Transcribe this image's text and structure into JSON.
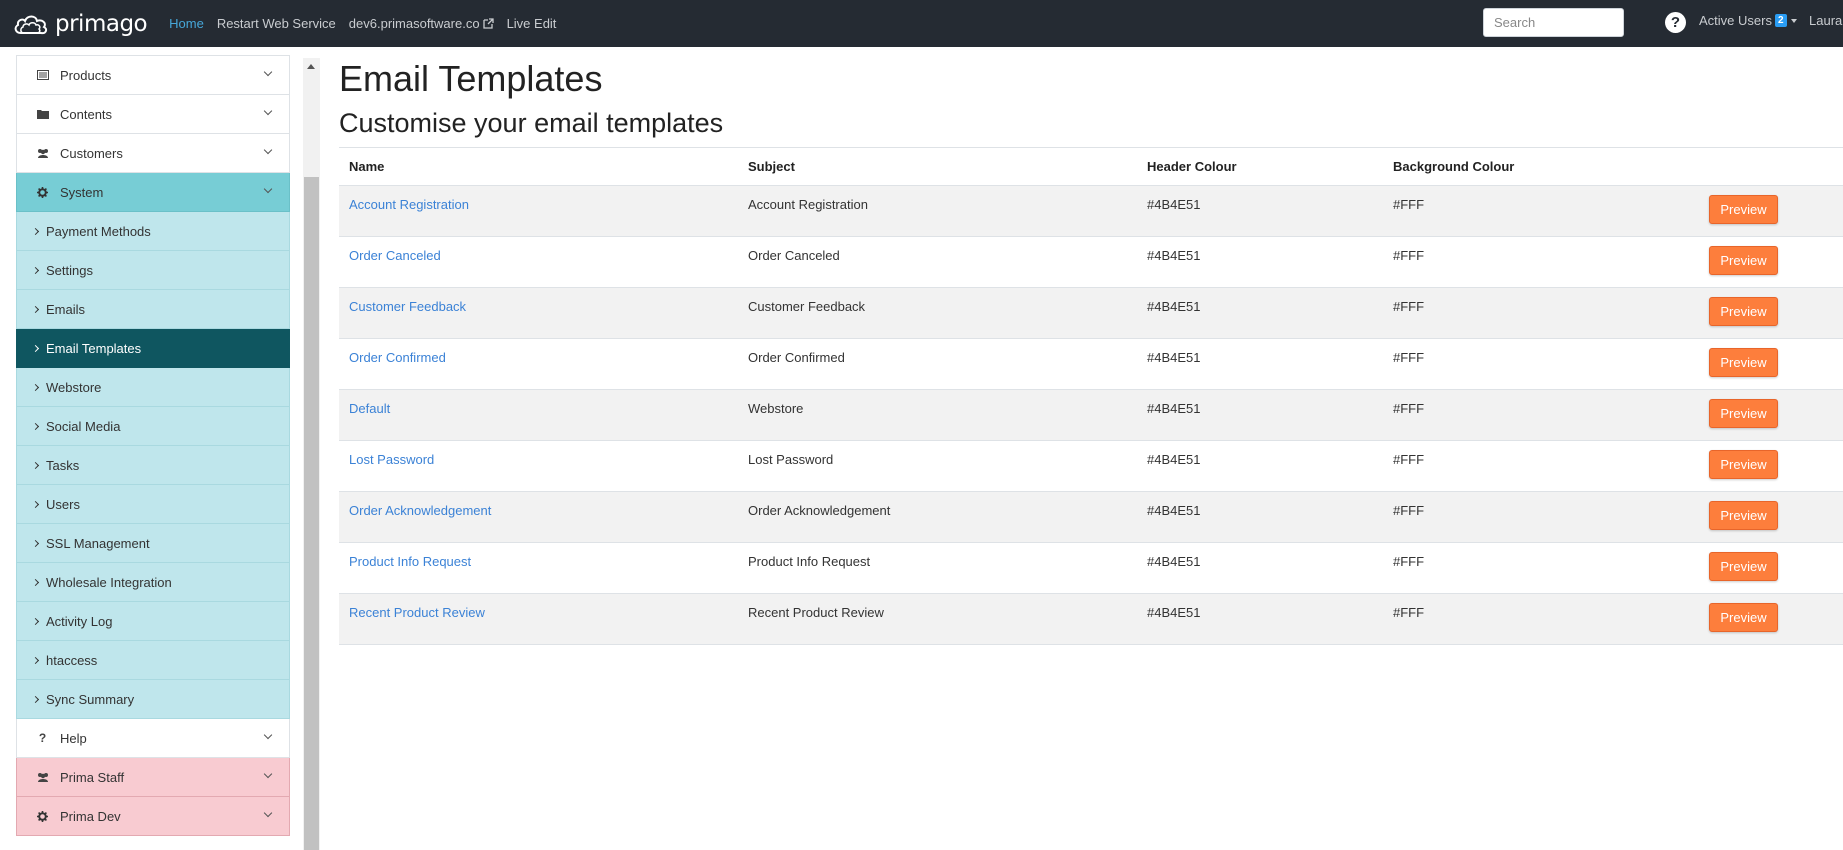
{
  "topbar": {
    "brand": "primago",
    "nav": [
      {
        "label": "Home"
      },
      {
        "label": "Restart Web Service"
      },
      {
        "label": "dev6.primasoftware.co"
      },
      {
        "label": "Live Edit"
      }
    ],
    "search_placeholder": "Search",
    "help": "?",
    "active_users_label": "Active Users",
    "active_users_count": "2",
    "user_name": "Laura",
    "colors": {
      "bar": "#252b33",
      "active_link": "#46a7d9",
      "badge": "#2a9df4"
    }
  },
  "sidebar": {
    "top_items": [
      {
        "label": "Products",
        "icon": "list-icon"
      },
      {
        "label": "Contents",
        "icon": "folder-icon"
      },
      {
        "label": "Customers",
        "icon": "users-icon"
      },
      {
        "label": "System",
        "icon": "gear-icon"
      }
    ],
    "system_items": [
      {
        "label": "Payment Methods"
      },
      {
        "label": "Settings"
      },
      {
        "label": "Emails"
      },
      {
        "label": "Email Templates"
      },
      {
        "label": "Webstore"
      },
      {
        "label": "Social Media"
      },
      {
        "label": "Tasks"
      },
      {
        "label": "Users"
      },
      {
        "label": "SSL Management"
      },
      {
        "label": "Wholesale Integration"
      },
      {
        "label": "Activity Log"
      },
      {
        "label": "htaccess"
      },
      {
        "label": "Sync Summary"
      }
    ],
    "active_item": "Email Templates",
    "bottom_items": [
      {
        "label": "Help",
        "icon": "question-icon"
      },
      {
        "label": "Prima Staff",
        "icon": "users-icon"
      },
      {
        "label": "Prima Dev",
        "icon": "gear-icon"
      }
    ],
    "colors": {
      "system": "#77cdd5",
      "sub": "#bfe6ec",
      "active": "#0f5660",
      "staff": "#f8cbd1"
    }
  },
  "main": {
    "title": "Email Templates",
    "subtitle": "Customise your email templates",
    "columns": [
      "Name",
      "Subject",
      "Header Colour",
      "Background Colour",
      ""
    ],
    "rows": [
      {
        "name": "Account Registration",
        "subject": "Account Registration",
        "header": "#4B4E51",
        "background": "#FFF",
        "action": "Preview"
      },
      {
        "name": "Order Canceled",
        "subject": "Order Canceled",
        "header": "#4B4E51",
        "background": "#FFF",
        "action": "Preview"
      },
      {
        "name": "Customer Feedback",
        "subject": "Customer Feedback",
        "header": "#4B4E51",
        "background": "#FFF",
        "action": "Preview"
      },
      {
        "name": "Order Confirmed",
        "subject": "Order Confirmed",
        "header": "#4B4E51",
        "background": "#FFF",
        "action": "Preview"
      },
      {
        "name": "Default",
        "subject": "Webstore",
        "header": "#4B4E51",
        "background": "#FFF",
        "action": "Preview"
      },
      {
        "name": "Lost Password",
        "subject": "Lost Password",
        "header": "#4B4E51",
        "background": "#FFF",
        "action": "Preview"
      },
      {
        "name": "Order Acknowledgement",
        "subject": "Order Acknowledgement",
        "header": "#4B4E51",
        "background": "#FFF",
        "action": "Preview"
      },
      {
        "name": "Product Info Request",
        "subject": "Product Info Request",
        "header": "#4B4E51",
        "background": "#FFF",
        "action": "Preview"
      },
      {
        "name": "Recent Product Review",
        "subject": "Recent Product Review",
        "header": "#4B4E51",
        "background": "#FFF",
        "action": "Preview"
      }
    ],
    "colors": {
      "link": "#3b82d6",
      "button": "#fd7e3c"
    }
  }
}
